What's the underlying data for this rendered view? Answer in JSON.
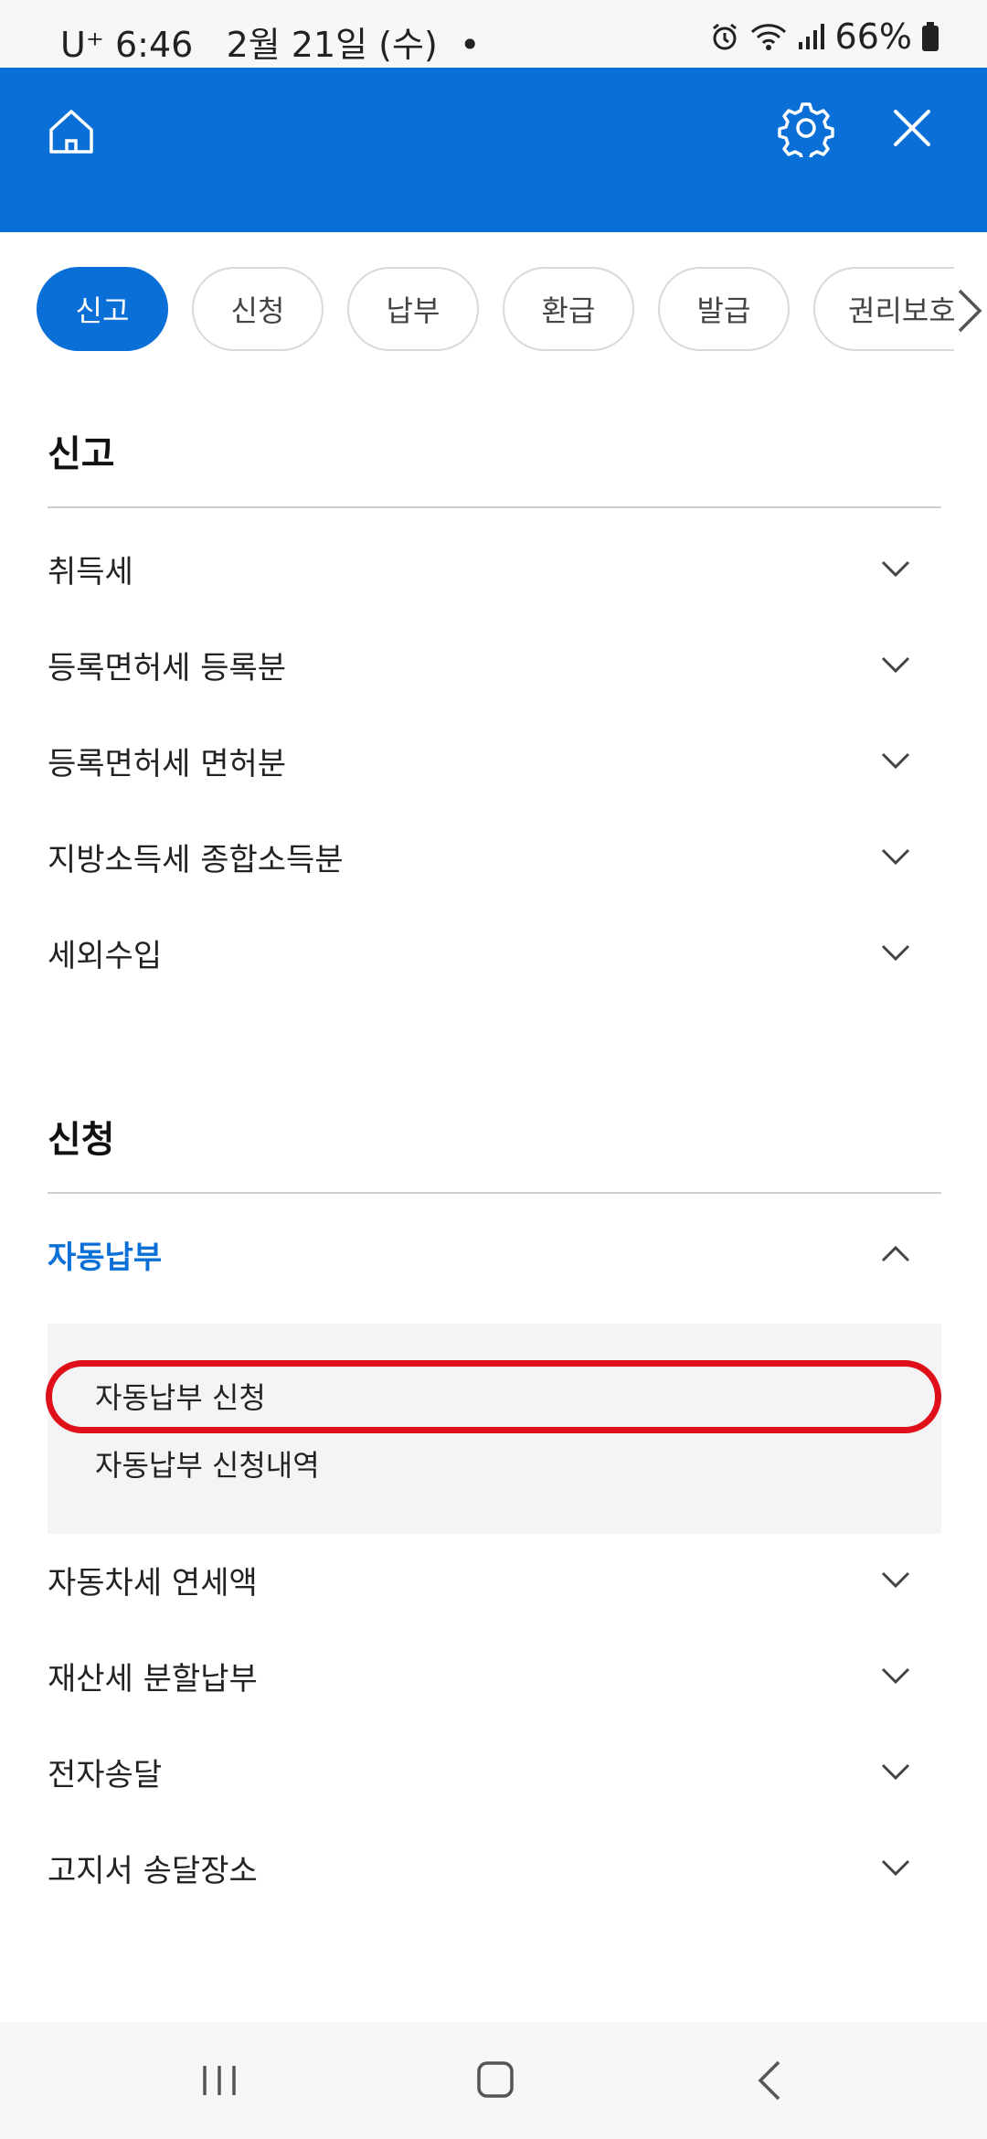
{
  "status": {
    "carrier": "U⁺",
    "time": "6:46",
    "date": "2월 21일 (수)",
    "dot": "•",
    "battery": "66%"
  },
  "appbar": {
    "home_icon": "home-icon",
    "settings_icon": "gear-icon",
    "close_icon": "close-icon",
    "color": "#0a6fd6"
  },
  "tabs": [
    {
      "label": "신고",
      "active": true
    },
    {
      "label": "신청",
      "active": false
    },
    {
      "label": "납부",
      "active": false
    },
    {
      "label": "환급",
      "active": false
    },
    {
      "label": "발급",
      "active": false
    },
    {
      "label": "권리보호",
      "active": false
    }
  ],
  "sections": {
    "report": {
      "title": "신고",
      "items": [
        "취득세",
        "등록면허세 등록분",
        "등록면허세 면허분",
        "지방소득세 종합소득분",
        "세외수입"
      ]
    },
    "apply": {
      "title": "신청",
      "open_item": "자동납부",
      "sub_items": [
        "자동납부 신청",
        "자동납부 신청내역"
      ],
      "items": [
        "자동차세 연세액",
        "재산세 분할납부",
        "전자송달",
        "고지서 송달장소"
      ]
    }
  },
  "highlight_color": "#e0101a"
}
